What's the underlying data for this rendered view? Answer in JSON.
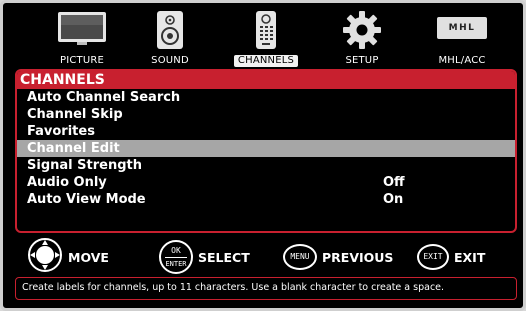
{
  "categories": [
    {
      "label": "PICTURE",
      "icon": "picture-icon",
      "active": false
    },
    {
      "label": "SOUND",
      "icon": "speaker-icon",
      "active": false
    },
    {
      "label": "CHANNELS",
      "icon": "remote-icon",
      "active": true
    },
    {
      "label": "SETUP",
      "icon": "gear-icon",
      "active": false
    },
    {
      "label": "MHL/ACC",
      "icon": "mhl-logo-icon",
      "active": false
    }
  ],
  "mhl_logo_text": "MHL",
  "menu": {
    "title": "CHANNELS",
    "items": [
      {
        "label": "Auto Channel Search",
        "value": ""
      },
      {
        "label": "Channel Skip",
        "value": ""
      },
      {
        "label": "Favorites",
        "value": ""
      },
      {
        "label": "Channel Edit",
        "value": "",
        "selected": true
      },
      {
        "label": "Signal Strength",
        "value": ""
      },
      {
        "label": "Audio Only",
        "value": "Off"
      },
      {
        "label": "Auto View Mode",
        "value": "On"
      }
    ]
  },
  "legend": {
    "move": "MOVE",
    "ok_top": "OK",
    "ok_bottom": "ENTER",
    "select": "SELECT",
    "menu_key": "MENU",
    "previous": "PREVIOUS",
    "exit_key": "EXIT",
    "exit": "EXIT"
  },
  "help_text": "Create labels for channels, up to 11 characters. Use a blank character to create a space.",
  "colors": {
    "accent_red": "#c8202f",
    "selected_row": "#a6a6a6",
    "background": "#000000"
  }
}
